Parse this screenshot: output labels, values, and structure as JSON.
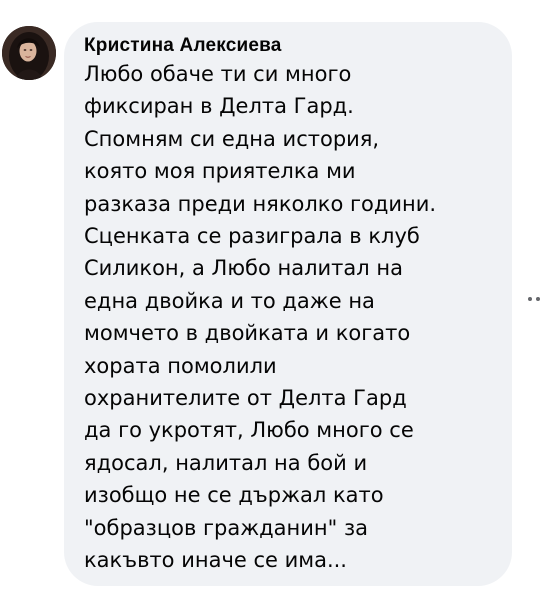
{
  "comment": {
    "author": "Кристина Алексиева",
    "text": "Любо обаче ти си много\nфиксиран в Делта Гард.\nСпомням си една история,\nкоято моя приятелка ми\nразказа преди няколко години.\nСценката се разиграла в клуб\nСиликон, а Любо налитал на\nедна двойка и то даже на\nмомчето в двойката и когато\nхората помолили\nохранителите от Делта Гард\nда го укротят, Любо много се\nядосал, налитал на бой и\nизобщо не се държал като\n\"образцов гражданин\" за\nкакъвто иначе се има...",
    "avatar_icon": "profile-photo",
    "more_options_icon": "more-horizontal-icon"
  },
  "colors": {
    "bubble_background": "#f0f2f5",
    "text": "#050505",
    "icon": "#65676b"
  }
}
